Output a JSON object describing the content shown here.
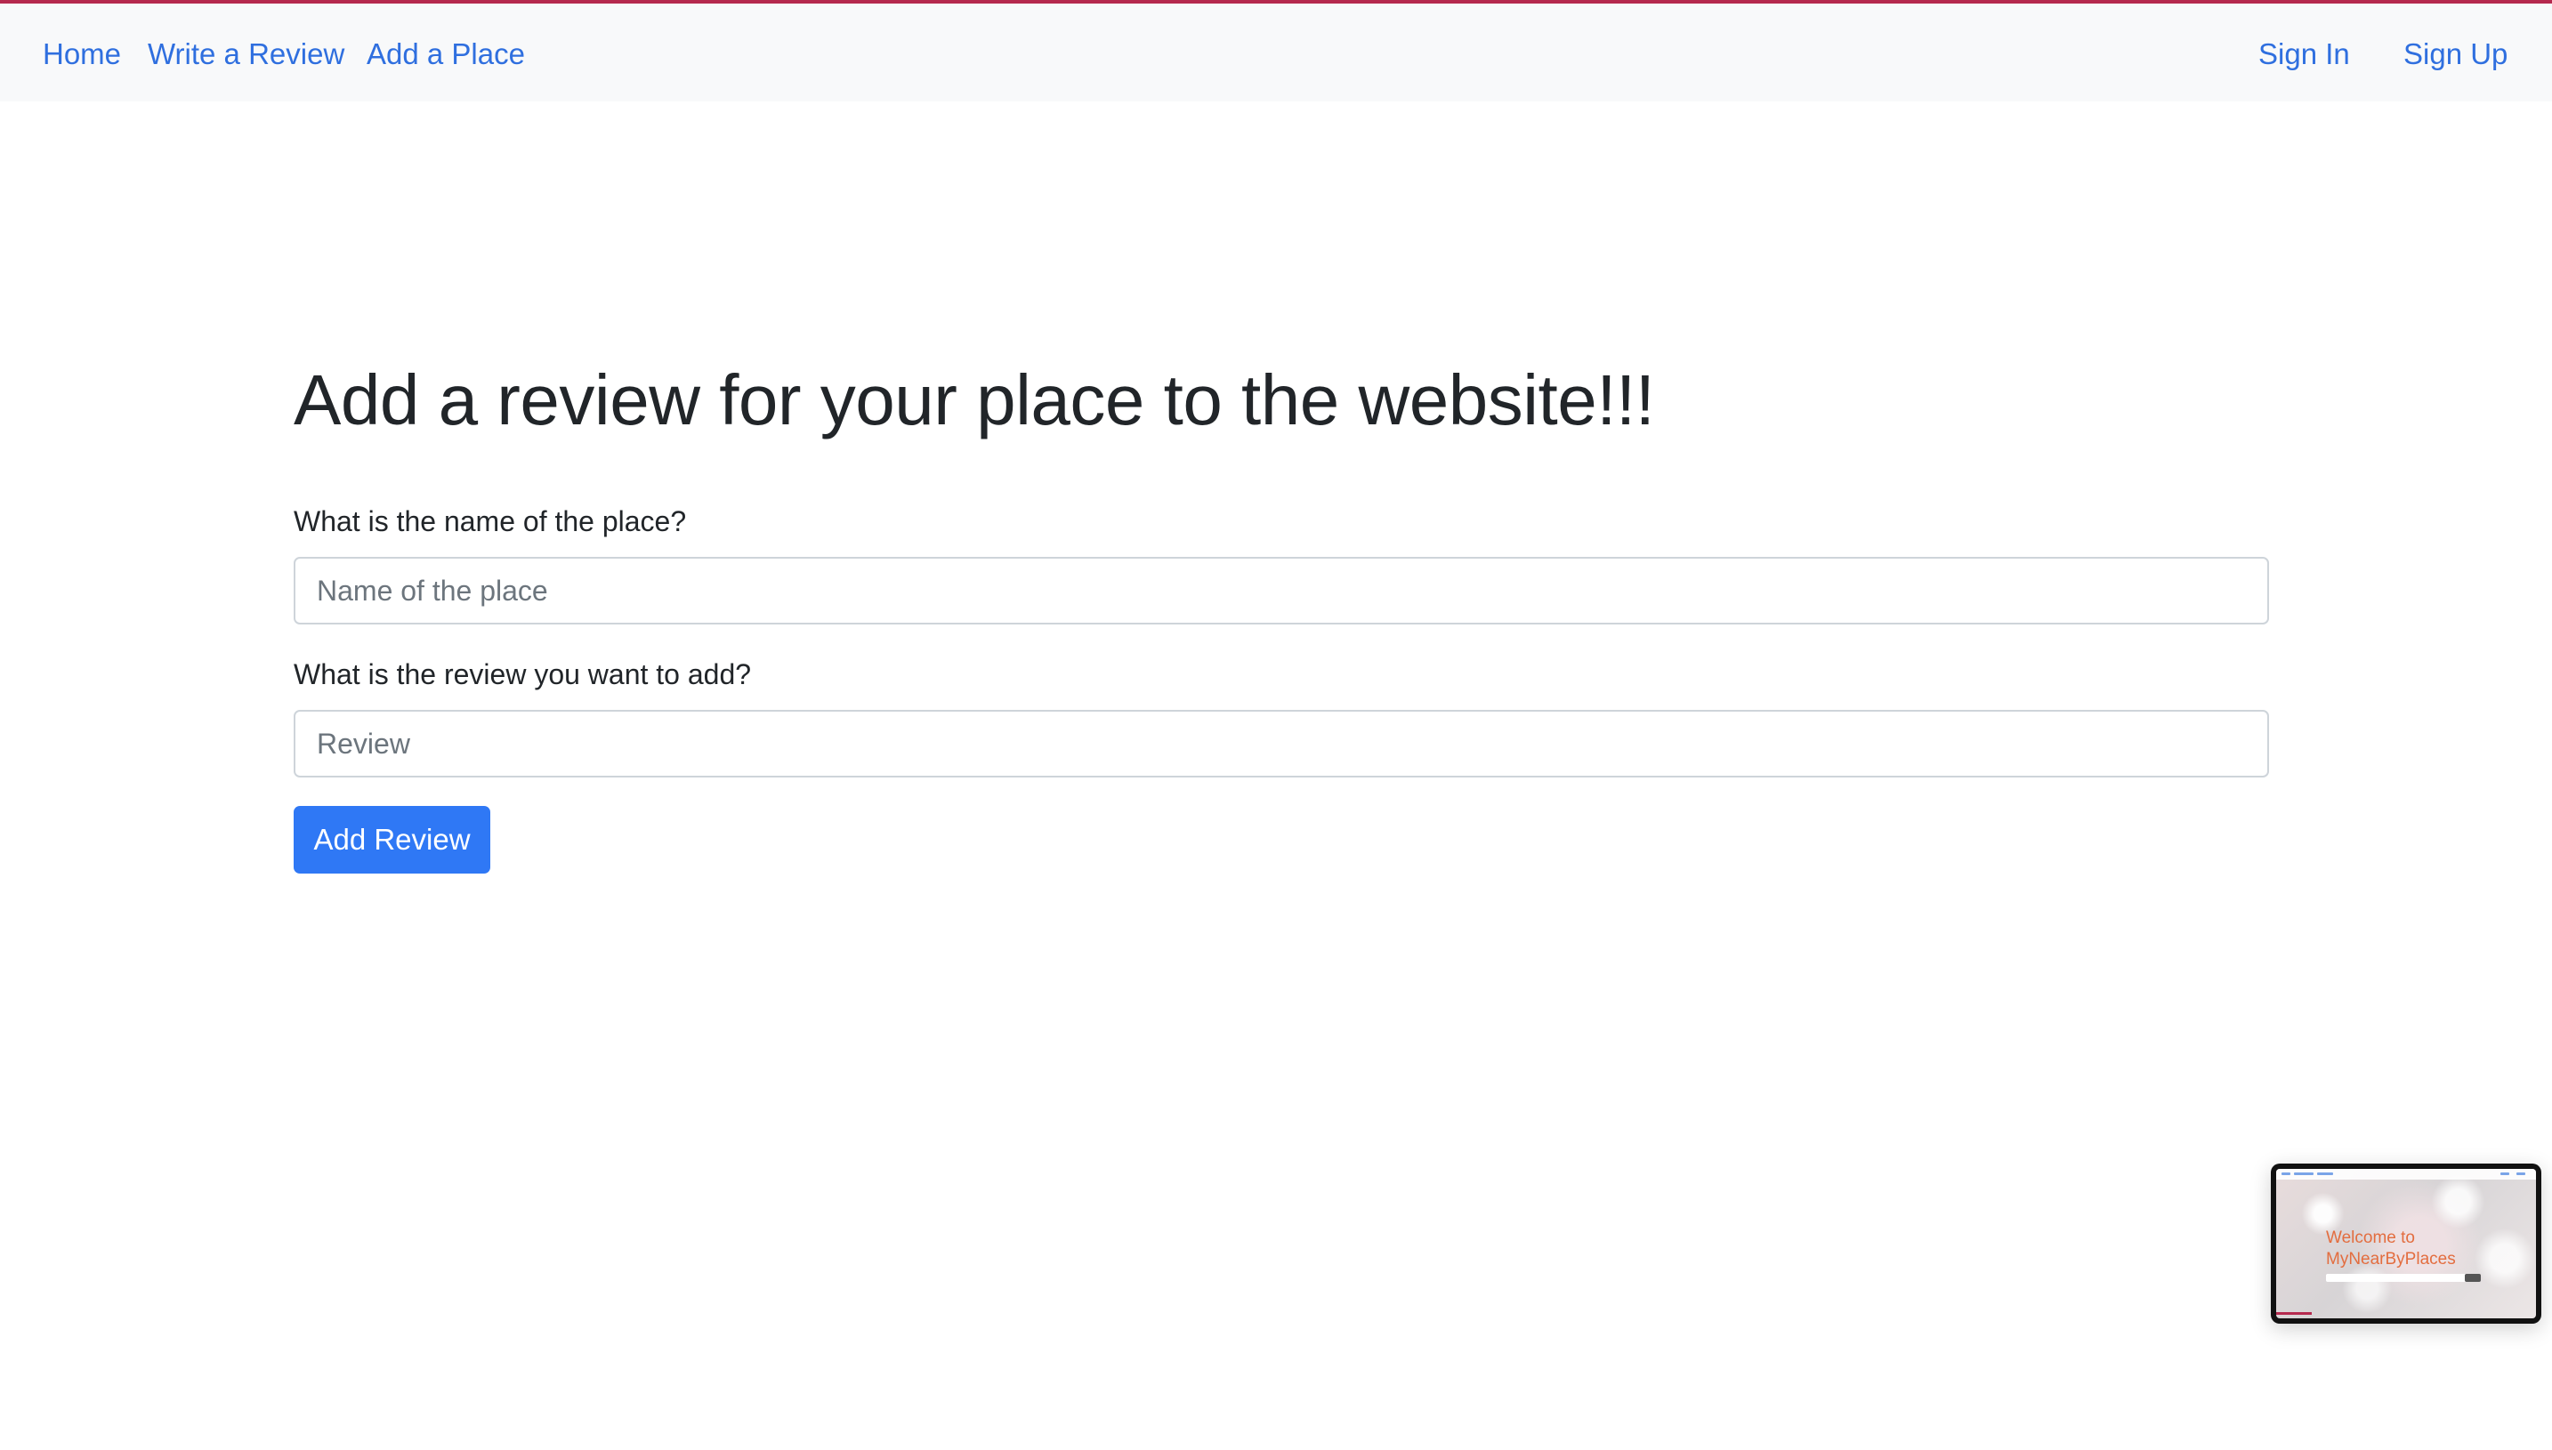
{
  "navbar": {
    "left_links": [
      "Home",
      "Write a Review",
      "Add a Place"
    ],
    "right_links": [
      "Sign In",
      "Sign Up"
    ],
    "accent_color": "#b5294e",
    "link_color": "#2f6fdf"
  },
  "form": {
    "heading": "Add a review for your place to the website!!!",
    "place_label": "What is the name of the place?",
    "place_placeholder": "Name of the place",
    "place_value": "",
    "review_label": "What is the review you want to add?",
    "review_placeholder": "Review",
    "review_value": "",
    "submit_label": "Add Review",
    "submit_color": "#2f78f5"
  },
  "preview_thumbnail": {
    "title": "Welcome to\nMyNearByPlaces",
    "title_color": "#e36d3f"
  }
}
